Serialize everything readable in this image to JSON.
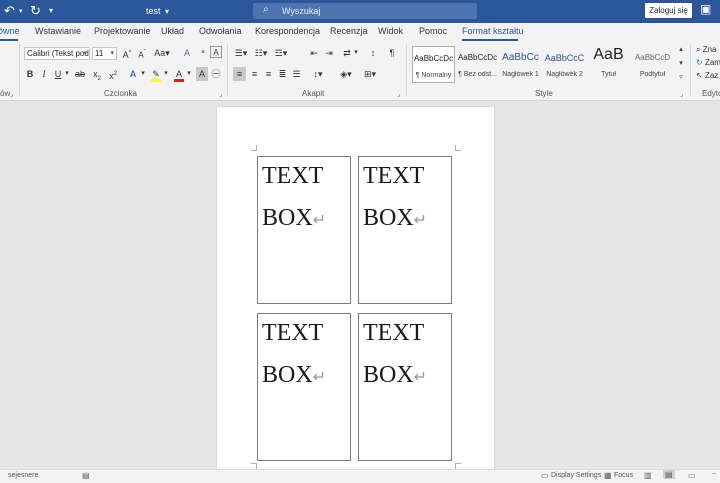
{
  "titlebar": {
    "undo_icon": "undo-icon",
    "redo_icon": "redo-icon",
    "doc_title": "test",
    "search_placeholder": "Wyszukaj",
    "login_label": "Zaloguj się"
  },
  "tabs": [
    "ówne",
    "Wstawianie",
    "Projektowanie",
    "Układ",
    "Odwołania",
    "Korespondencja",
    "Recenzja",
    "Widok",
    "Pomoc",
    "Format kształtu"
  ],
  "ribbon": {
    "clipboard_label": "ów",
    "font_group_label": "Czcionka",
    "paragraph_group_label": "Akapit",
    "styles_group_label": "Style",
    "editing_group_label": "Edyto",
    "font_name": "Calibri (Tekst pod",
    "font_size": "11",
    "styles": [
      {
        "sample": "AaBbCcDc",
        "name": "¶ Normalny"
      },
      {
        "sample": "AaBbCcDc",
        "name": "¶ Bez odst..."
      },
      {
        "sample": "AaBbCc",
        "name": "Nagłówek 1"
      },
      {
        "sample": "AaBbCcC",
        "name": "Nagłówek 2"
      },
      {
        "sample": "AaB",
        "name": "Tytuł"
      },
      {
        "sample": "AaBbCcD",
        "name": "Podtytuł"
      }
    ],
    "editing": [
      "Zna",
      "Zam",
      "Zaz"
    ]
  },
  "document": {
    "textboxes": [
      {
        "line1": "TEXT",
        "line2": "BOX"
      },
      {
        "line1": "TEXT",
        "line2": "BOX"
      },
      {
        "line1": "TEXT",
        "line2": "BOX"
      },
      {
        "line1": "TEXT",
        "line2": "BOX"
      }
    ],
    "return_mark": "↵"
  },
  "statusbar": {
    "left_text": "sejesnere",
    "display_settings": "Display Settings",
    "focus": "Focus"
  },
  "colors": {
    "title_bar": "#2b579a",
    "ribbon_bg": "#f3f3f3",
    "canvas_bg": "#e6e6e6",
    "highlight_yellow": "#ffff00",
    "font_color_red": "#e02020"
  }
}
